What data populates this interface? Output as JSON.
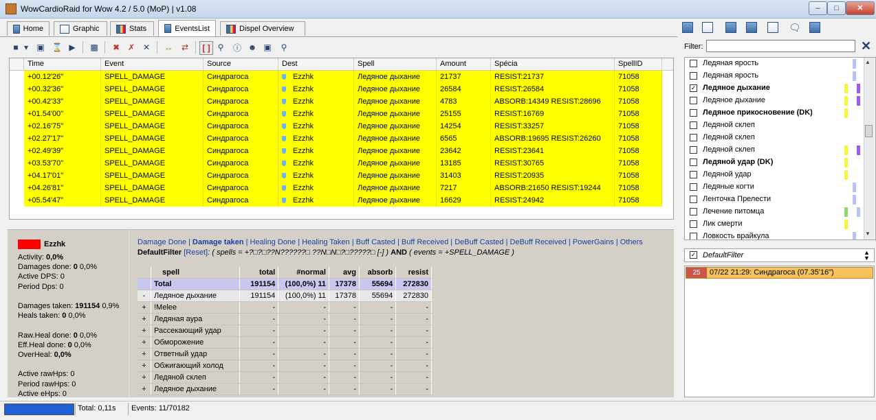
{
  "window": {
    "title": "WowCardioRaid for Wow 4.2 / 5.0 (MoP) | v1.08"
  },
  "tabs": [
    {
      "label": "Home",
      "icon": "home-icon"
    },
    {
      "label": "Graphic",
      "icon": "graphic-icon"
    },
    {
      "label": "Stats",
      "icon": "stats-icon"
    },
    {
      "label": "EventsList",
      "icon": "events-list-icon",
      "active": true
    },
    {
      "label": "Dispel Overview",
      "icon": "dispel-icon"
    }
  ],
  "grid": {
    "columns": [
      "Time",
      "Event",
      "Source",
      "Dest",
      "Spell",
      "Amount",
      "Spécia",
      "SpellID"
    ],
    "rows": [
      [
        "+00.12'26\"",
        "SPELL_DAMAGE",
        "Синдрагоса",
        "Ezzhk",
        "Ледяное дыхание",
        "21737",
        "RESIST:21737",
        "71058"
      ],
      [
        "+00.32'36\"",
        "SPELL_DAMAGE",
        "Синдрагоса",
        "Ezzhk",
        "Ледяное дыхание",
        "26584",
        "RESIST:26584",
        "71058"
      ],
      [
        "+00.42'33\"",
        "SPELL_DAMAGE",
        "Синдрагоса",
        "Ezzhk",
        "Ледяное дыхание",
        "4783",
        "ABSORB:14349 RESIST:28696",
        "71058"
      ],
      [
        "+01.54'00\"",
        "SPELL_DAMAGE",
        "Синдрагоса",
        "Ezzhk",
        "Ледяное дыхание",
        "25155",
        "RESIST:16769",
        "71058"
      ],
      [
        "+02.16'75\"",
        "SPELL_DAMAGE",
        "Синдрагоса",
        "Ezzhk",
        "Ледяное дыхание",
        "14254",
        "RESIST:33257",
        "71058"
      ],
      [
        "+02.27'17\"",
        "SPELL_DAMAGE",
        "Синдрагоса",
        "Ezzhk",
        "Ледяное дыхание",
        "6565",
        "ABSORB:19695 RESIST:26260",
        "71058"
      ],
      [
        "+02.49'39\"",
        "SPELL_DAMAGE",
        "Синдрагоса",
        "Ezzhk",
        "Ледяное дыхание",
        "23642",
        "RESIST:23641",
        "71058"
      ],
      [
        "+03.53'70\"",
        "SPELL_DAMAGE",
        "Синдрагоса",
        "Ezzhk",
        "Ледяное дыхание",
        "13185",
        "RESIST:30765",
        "71058"
      ],
      [
        "+04.17'01\"",
        "SPELL_DAMAGE",
        "Синдрагоса",
        "Ezzhk",
        "Ледяное дыхание",
        "31403",
        "RESIST:20935",
        "71058"
      ],
      [
        "+04.26'81\"",
        "SPELL_DAMAGE",
        "Синдрагоса",
        "Ezzhk",
        "Ледяное дыхание",
        "7217",
        "ABSORB:21650 RESIST:19244",
        "71058"
      ],
      [
        "+05.54'47\"",
        "SPELL_DAMAGE",
        "Синдрагоса",
        "Ezzhk",
        "Ледяное дыхание",
        "16629",
        "RESIST:24942",
        "71058"
      ]
    ]
  },
  "player": {
    "name": "Ezzhk",
    "color": "#ff0000",
    "stats": [
      {
        "label": "Activity: ",
        "value": "0,0%",
        "bold_value": true
      },
      {
        "label": "Damages done: ",
        "value": "0",
        "rest": " 0,0%"
      },
      {
        "label": "Active DPS: 0"
      },
      {
        "label": "Period Dps: 0"
      },
      {
        "label": ""
      },
      {
        "label": "Damages taken: ",
        "value": "191154",
        "rest": " 0,9%"
      },
      {
        "label": "Heals taken: ",
        "value": "0",
        "rest": " 0,0%"
      },
      {
        "label": ""
      },
      {
        "label": "Raw.Heal done: ",
        "value": "0",
        "rest": " 0,0%"
      },
      {
        "label": "Eff.Heal done: ",
        "value": "0",
        "rest": " 0,0%"
      },
      {
        "label": "OverHeal: ",
        "value": "0,0%",
        "bold_value": true
      },
      {
        "label": ""
      },
      {
        "label": "Active rawHps: 0"
      },
      {
        "label": "Period rawHps: 0"
      },
      {
        "label": "Active eHps: 0"
      }
    ]
  },
  "detail_links": [
    "Damage Done",
    "Damage taken",
    "Healing Done",
    "Healing Taken",
    "Buff Casted",
    "Buff Received",
    "DeBuff Casted",
    "DeBuff Received",
    "PowerGains",
    "Others"
  ],
  "detail_active": "Damage taken",
  "filter_line": {
    "name": "DefaultFilter",
    "reset": "[Reset]",
    "expr1": ": ( spells = +?□?□??N??????□ ??N□N□?□?????□ [-] ) ",
    "and": "AND",
    "expr2": " ( events = +SPELL_DAMAGE )"
  },
  "detail_table": {
    "columns": [
      "spell",
      "total",
      "#normal",
      "avg",
      "absorb",
      "resist"
    ],
    "total": {
      "label": "Total",
      "total": "191154",
      "normal": "(100,0%)  11",
      "avg": "17378",
      "absorb": "55694",
      "resist": "272830"
    },
    "rows": [
      {
        "toggle": "-",
        "spell": "Ледяное дыхание",
        "total": "191154",
        "normal": "(100,0%)  11",
        "avg": "17378",
        "absorb": "55694",
        "resist": "272830"
      },
      {
        "toggle": "+",
        "spell": "!Melee",
        "total": "-",
        "normal": "-",
        "avg": "-",
        "absorb": "-",
        "resist": "-"
      },
      {
        "toggle": "+",
        "spell": "Ледяная аура",
        "total": "-",
        "normal": "-",
        "avg": "-",
        "absorb": "-",
        "resist": "-"
      },
      {
        "toggle": "+",
        "spell": "Рассекающий удар",
        "total": "-",
        "normal": "-",
        "avg": "-",
        "absorb": "-",
        "resist": "-"
      },
      {
        "toggle": "+",
        "spell": "Обморожение",
        "total": "-",
        "normal": "-",
        "avg": "-",
        "absorb": "-",
        "resist": "-"
      },
      {
        "toggle": "+",
        "spell": "Ответный удар",
        "total": "-",
        "normal": "-",
        "avg": "-",
        "absorb": "-",
        "resist": "-"
      },
      {
        "toggle": "+",
        "spell": "Обжигающий холод",
        "total": "-",
        "normal": "-",
        "avg": "-",
        "absorb": "-",
        "resist": "-"
      },
      {
        "toggle": "+",
        "spell": "Ледяной склеп",
        "total": "-",
        "normal": "-",
        "avg": "-",
        "absorb": "-",
        "resist": "-"
      },
      {
        "toggle": "+",
        "spell": "Ледяное дыхание",
        "total": "-",
        "normal": "-",
        "avg": "-",
        "absorb": "-",
        "resist": "-"
      }
    ]
  },
  "status": {
    "total": "Total: 0,11s",
    "events": "Events: 11/70182"
  },
  "right": {
    "filter_label": "Filter:",
    "filter_value": "",
    "spells": [
      {
        "label": "Ледяная ярость",
        "checked": false,
        "bold": false,
        "bars": [
          "#b7c3f2"
        ]
      },
      {
        "label": "Ледяная ярость",
        "checked": false,
        "bold": false,
        "bars": [
          "#b7c3f2"
        ]
      },
      {
        "label": "Ледяное дыхание",
        "checked": true,
        "bold": true,
        "bars": [
          "#f5f53a",
          "#a05ce8"
        ]
      },
      {
        "label": "Ледяное дыхание",
        "checked": false,
        "bold": false,
        "bars": [
          "#f5f53a",
          "#a05ce8"
        ]
      },
      {
        "label": "Ледяное прикосновение (DK)",
        "checked": false,
        "bold": true,
        "bars": [
          "#f5f53a"
        ]
      },
      {
        "label": "Ледяной склеп",
        "checked": false,
        "bold": false,
        "bars": []
      },
      {
        "label": "Ледяной склеп",
        "checked": false,
        "bold": false,
        "bars": []
      },
      {
        "label": "Ледяной склеп",
        "checked": false,
        "bold": false,
        "bars": [
          "#f5f53a",
          "#a05ce8"
        ]
      },
      {
        "label": "Ледяной удар (DK)",
        "checked": false,
        "bold": true,
        "bars": [
          "#f5f53a"
        ]
      },
      {
        "label": "Ледяной удар",
        "checked": false,
        "bold": false,
        "bars": [
          "#f5f53a"
        ]
      },
      {
        "label": "Ледяные когти",
        "checked": false,
        "bold": false,
        "bars": [
          "#b7c3f2"
        ]
      },
      {
        "label": "Ленточка Прелести",
        "checked": false,
        "bold": false,
        "bars": [
          "#b7c3f2"
        ]
      },
      {
        "label": "Лечение питомца",
        "checked": false,
        "bold": false,
        "bars": [
          "#8fd86a",
          "#b7c3f2"
        ]
      },
      {
        "label": "Лик смерти",
        "checked": false,
        "bold": false,
        "bars": [
          "#f5f53a"
        ]
      },
      {
        "label": "Ловкость врайкула",
        "checked": false,
        "bold": false,
        "bars": [
          "#b7c3f2"
        ]
      }
    ],
    "default_filter": {
      "label": "DefaultFilter",
      "checked": true
    },
    "saved_event": {
      "num": "25",
      "text": "07/22  21:29: Синдрагоса (07.35'16\")"
    }
  }
}
